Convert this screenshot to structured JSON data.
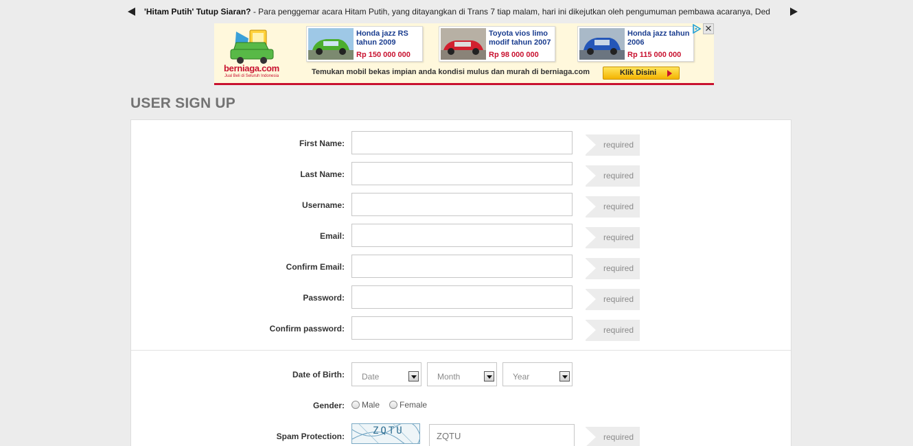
{
  "ticker": {
    "headline": "'Hitam Putih' Tutup Siaran?",
    "separator": " - ",
    "body": "Para penggemar acara Hitam Putih, yang ditayangkan di Trans 7 tiap malam, hari ini dikejutkan oleh pengumuman pembawa acaranya, Ded"
  },
  "ad": {
    "brand": "berniaga.com",
    "tagline": "Jual Beli di Seluruh Indonesia",
    "cards": [
      {
        "title": "Honda jazz RS tahun 2009",
        "price": "Rp 150 000 000",
        "color": "#4cae2e"
      },
      {
        "title": "Toyota vios limo modif tahun 2007",
        "price": "Rp 98 000 000",
        "color": "#d2202f"
      },
      {
        "title": "Honda jazz tahun 2006",
        "price": "Rp 115 000 000",
        "color": "#2456b8"
      }
    ],
    "bottom_text": "Temukan mobil bekas impian anda kondisi mulus dan murah di berniaga.com",
    "cta": "Klik Disini",
    "close": "✕"
  },
  "page": {
    "title": "USER SIGN UP"
  },
  "form": {
    "fields": [
      {
        "label": "First Name:",
        "value": "",
        "required": "required"
      },
      {
        "label": "Last Name:",
        "value": "",
        "required": "required"
      },
      {
        "label": "Username:",
        "value": "",
        "required": "required"
      },
      {
        "label": "Email:",
        "value": "",
        "required": "required"
      },
      {
        "label": "Confirm Email:",
        "value": "",
        "required": "required"
      },
      {
        "label": "Password:",
        "value": "",
        "required": "required"
      },
      {
        "label": "Confirm password:",
        "value": "",
        "required": "required"
      }
    ],
    "dob": {
      "label": "Date of Birth:",
      "date": "Date",
      "month": "Month",
      "year": "Year"
    },
    "gender": {
      "label": "Gender:",
      "male": "Male",
      "female": "Female"
    },
    "spam": {
      "label": "Spam Protection:",
      "captcha": "ZQTU",
      "placeholder": "ZQTU",
      "required": "required"
    }
  },
  "colors": {
    "accent_red": "#c8102e",
    "ad_blue": "#1a3d8f",
    "title_gray": "#737373"
  }
}
